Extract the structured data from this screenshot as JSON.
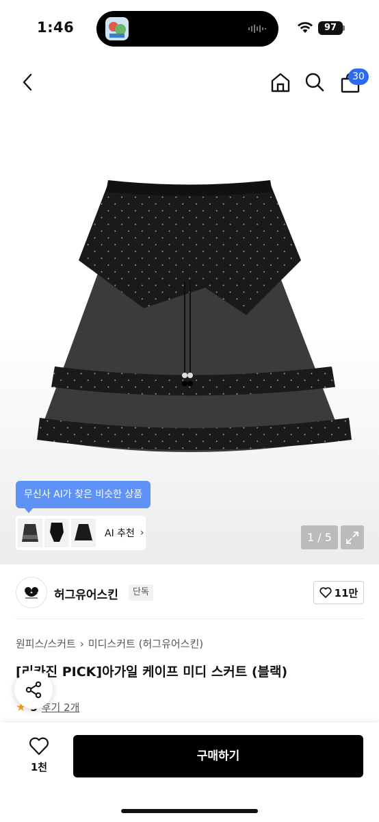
{
  "status_bar": {
    "time": "1:46",
    "battery": "97"
  },
  "nav": {
    "cart_count": "30"
  },
  "image": {
    "counter": "1 / 5"
  },
  "ai": {
    "tooltip": "무신사 AI가 찾은 비슷한 상품",
    "recommend_label": "AI 추천"
  },
  "brand": {
    "name": "허그유어스킨",
    "tag": "단독",
    "likes": "11만"
  },
  "breadcrumb": {
    "category": "원피스/스커트",
    "sub": "미디스커트 (허그유어스킨)"
  },
  "product": {
    "title": "[리카진 PICK]아가일 케이프 미디 스커트 (블랙)",
    "rating": "5",
    "reviews": "후기 2개"
  },
  "bottom": {
    "wish_count": "1천",
    "buy_label": "구매하기"
  },
  "colors": {
    "accent_blue": "#2c6bf0",
    "tooltip_blue": "#5e92f6",
    "star": "#f5a623"
  }
}
